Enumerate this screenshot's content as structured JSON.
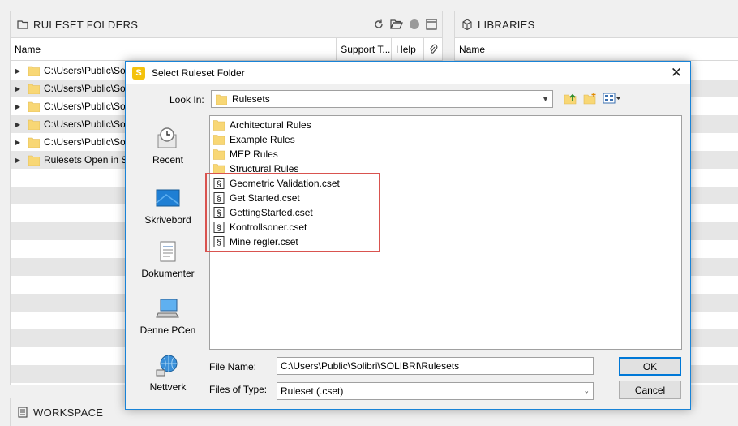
{
  "left_panel": {
    "title": "RULESET FOLDERS",
    "columns": [
      "Name",
      "Support T...",
      "Help"
    ],
    "rows": [
      "C:\\Users\\Public\\Solibri",
      "C:\\Users\\Public\\Solibri",
      "C:\\Users\\Public\\Solibri",
      "C:\\Users\\Public\\Solibri",
      "C:\\Users\\Public\\Solibri",
      "Rulesets Open in Solibri"
    ]
  },
  "right_panel": {
    "title": "LIBRARIES",
    "columns": [
      "Name"
    ]
  },
  "bottom_panel": {
    "title": "WORKSPACE"
  },
  "dialog": {
    "title": "Select Ruleset Folder",
    "look_in_label": "Look In:",
    "look_in_value": "Rulesets",
    "places": [
      "Recent",
      "Skrivebord",
      "Dokumenter",
      "Denne PCen",
      "Nettverk"
    ],
    "folders": [
      "Architectural Rules",
      "Example Rules",
      "MEP Rules",
      "Structural Rules"
    ],
    "files": [
      "Geometric Validation.cset",
      "Get Started.cset",
      "GettingStarted.cset",
      "Kontrollsoner.cset",
      "Mine regler.cset"
    ],
    "file_name_label": "File Name:",
    "file_name_value": "C:\\Users\\Public\\Solibri\\SOLIBRI\\Rulesets",
    "file_type_label": "Files of Type:",
    "file_type_value": "Ruleset (.cset)",
    "ok_label": "OK",
    "cancel_label": "Cancel"
  },
  "colors": {
    "accent": "#1883d7",
    "highlight": "#d9534f",
    "folder": "#f8d775"
  }
}
